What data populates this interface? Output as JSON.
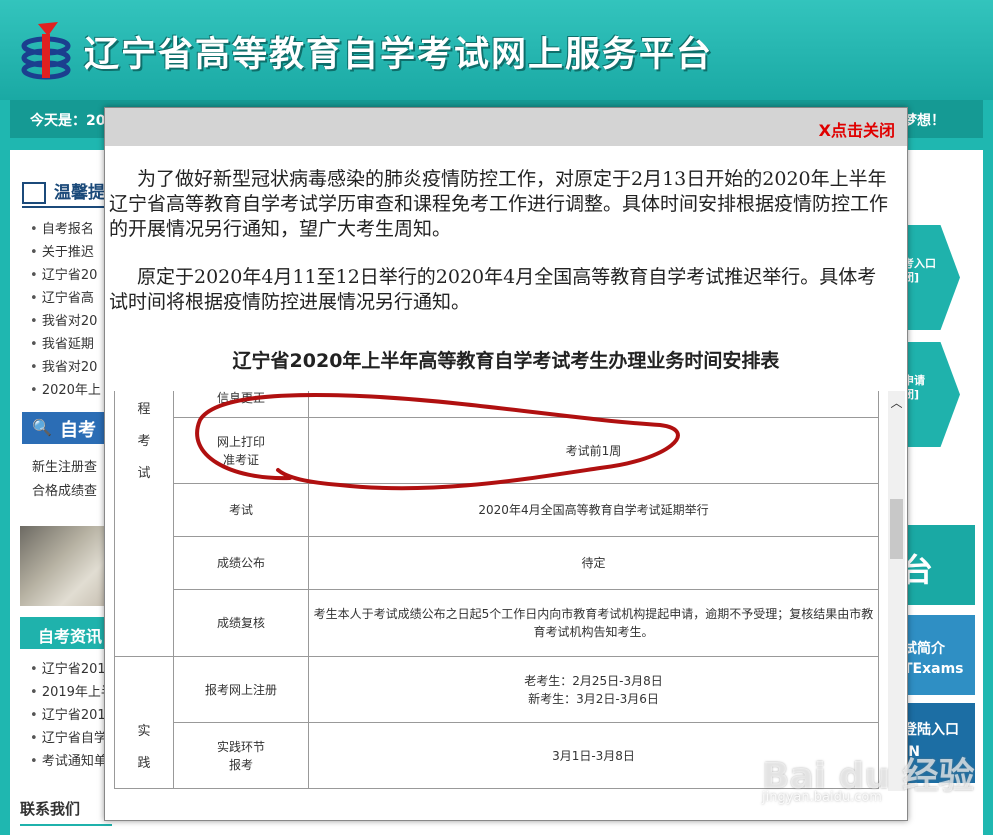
{
  "site": {
    "title": "辽宁省高等教育自学考试网上服务平台",
    "date_label": "今天是：20",
    "slogan_tail": "梦想！"
  },
  "sidebar": {
    "notice_head": "温馨提",
    "news": [
      "自考报名",
      "关于推迟",
      "辽宁省20",
      "辽宁省高",
      "我省对20",
      "我省延期",
      "我省对20",
      "2020年上"
    ],
    "search_head": "自考查",
    "links": [
      "新生注册查",
      "合格成绩查"
    ],
    "info_tab": "自考资讯",
    "info_news": [
      "辽宁省201",
      "2019年上半",
      "辽宁省201",
      "辽宁省自学",
      "考试通知单"
    ],
    "contact": "联系我们"
  },
  "right_panel": {
    "entry1": "考入口\n闭]",
    "entry2": "申请\n闭]",
    "platform_char": "台",
    "intro": "试简介\nTExams",
    "login": "登陆入口\nIN"
  },
  "modal": {
    "close_label": "X点击关闭",
    "para1": "为了做好新型冠状病毒感染的肺炎疫情防控工作，对原定于2月13日开始的2020年上半年辽宁省高等教育自学考试学历审查和课程免考工作进行调整。具体时间安排根据疫情防控工作的开展情况另行通知，望广大考生周知。",
    "para2": "原定于2020年4月11至12日举行的2020年4月全国高等教育自学考试推迟举行。具体考试时间将根据疫情防控进展情况另行通知。",
    "table_title": "辽宁省2020年上半年高等教育自学考试考生办理业务时间安排表",
    "table": {
      "cat1": [
        "程",
        "考",
        "试"
      ],
      "rows1": [
        {
          "item": "信息更正",
          "value": ""
        },
        {
          "item": "网上打印\n准考证",
          "value": "考试前1周"
        },
        {
          "item": "考试",
          "value": "2020年4月全国高等教育自学考试延期举行"
        },
        {
          "item": "成绩公布",
          "value": "待定"
        },
        {
          "item": "成绩复核",
          "value": "考生本人于考试成绩公布之日起5个工作日内向市教育考试机构提起申请，逾期不予受理；复核结果由市教育考试机构告知考生。"
        }
      ],
      "cat2": [
        "实",
        "践"
      ],
      "rows2": [
        {
          "item": "报考网上注册",
          "value": "老考生：2月25日-3月8日\n新考生：3月2日-3月6日"
        },
        {
          "item": "实践环节\n报考",
          "value": "3月1日-3月8日"
        }
      ]
    }
  },
  "watermark": {
    "brand": "Bai du 经验",
    "url": "jingyan.baidu.com"
  }
}
